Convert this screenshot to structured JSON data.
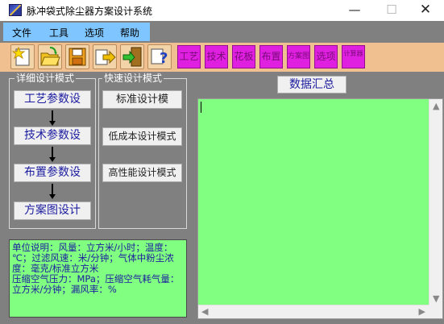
{
  "window": {
    "title": "脉冲袋式除尘器方案设计系统",
    "minimize": "—",
    "maximize": "☐",
    "close": "✕"
  },
  "menu": {
    "items": [
      "文件",
      "工具",
      "选项",
      "帮助"
    ]
  },
  "toolbar": {
    "icons": [
      "new-icon",
      "open-icon",
      "save-icon",
      "export-icon",
      "exit-icon",
      "help-icon"
    ],
    "magenta_buttons": [
      "工艺",
      "技术",
      "花板",
      "布置",
      "方案图",
      "选项",
      "计算器"
    ]
  },
  "detail_mode": {
    "title": "详细设计模式",
    "buttons": [
      "工艺参数设",
      "技术参数设",
      "布置参数设",
      "方案图设计"
    ]
  },
  "quick_mode": {
    "title": "快速设计模式",
    "buttons": [
      "标准设计模",
      "低成本设计模式",
      "高性能设计模式"
    ]
  },
  "summary_button": "数据汇总",
  "notes": {
    "text": "单位说明：风量：立方米/小时；温度：℃；过滤风速：米/分钟；气体中粉尘浓度：毫克/标准立方米\n压缩空气压力：MPa；压缩空气耗气量：立方米/分钟；漏风率：%"
  },
  "colors": {
    "background": "#808080",
    "menubar": "#7fc5ff",
    "toolbar": "#f0c090",
    "magenta": "#e020e0",
    "green_panel": "#80ff80",
    "button_text": "#1c1ca0"
  }
}
